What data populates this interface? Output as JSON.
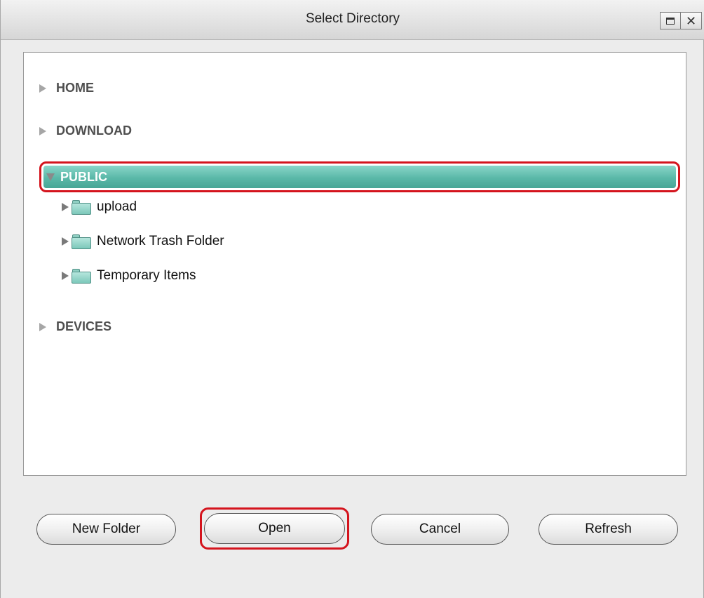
{
  "window": {
    "title": "Select Directory",
    "controls": [
      "restore-icon",
      "close-icon"
    ],
    "close_glyph": "✕"
  },
  "tree": {
    "roots": [
      {
        "label": "HOME",
        "expanded": false
      },
      {
        "label": "DOWNLOAD",
        "expanded": false
      },
      {
        "label": "PUBLIC",
        "expanded": true,
        "selected": true
      },
      {
        "label": "DEVICES",
        "expanded": false
      }
    ],
    "public_children": [
      {
        "label": "upload",
        "icon": "folder-icon"
      },
      {
        "label": "Network Trash Folder",
        "icon": "folder-icon"
      },
      {
        "label": "Temporary Items",
        "icon": "folder-icon"
      }
    ]
  },
  "buttons": {
    "new_folder": "New Folder",
    "open": "Open",
    "cancel": "Cancel",
    "refresh": "Refresh"
  },
  "colors": {
    "selection_fill": "#5ab8a8",
    "highlight_outline": "#d4141d",
    "folder": "#8fcfc2"
  }
}
